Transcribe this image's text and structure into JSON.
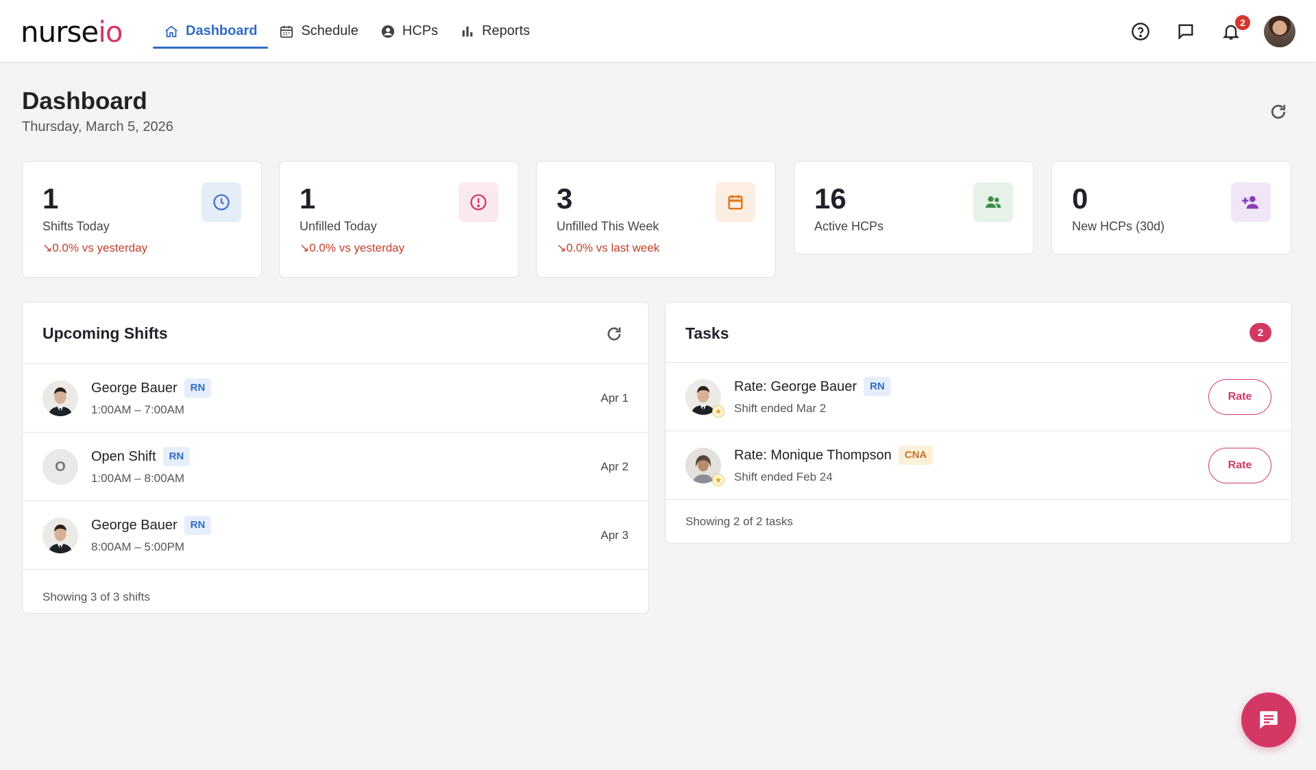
{
  "app": {
    "logo_main": "nurse",
    "logo_accent": "io"
  },
  "nav": {
    "items": [
      {
        "label": "Dashboard",
        "icon": "home-icon",
        "active": true
      },
      {
        "label": "Schedule",
        "icon": "calendar-icon",
        "active": false
      },
      {
        "label": "HCPs",
        "icon": "person-circle-icon",
        "active": false
      },
      {
        "label": "Reports",
        "icon": "bar-chart-icon",
        "active": false
      }
    ]
  },
  "topbar": {
    "notification_count": "2",
    "icons": [
      "help-icon",
      "chat-icon",
      "bell-icon",
      "user-avatar"
    ]
  },
  "header": {
    "title": "Dashboard",
    "date": "Thursday, March 5, 2026"
  },
  "stats": [
    {
      "value": "1",
      "label": "Shifts Today",
      "trend": "↘0.0% vs yesterday",
      "icon": "clock-icon",
      "icon_color": "#3d74c4",
      "icon_bg": "#e5edf8"
    },
    {
      "value": "1",
      "label": "Unfilled Today",
      "trend": "↘0.0% vs yesterday",
      "icon": "alert-circle-icon",
      "icon_color": "#d33865",
      "icon_bg": "#fbe9ee"
    },
    {
      "value": "3",
      "label": "Unfilled This Week",
      "trend": "↘0.0% vs last week",
      "icon": "calendar-icon",
      "icon_color": "#e07a1f",
      "icon_bg": "#fcefe2"
    },
    {
      "value": "16",
      "label": "Active HCPs",
      "icon": "people-icon",
      "icon_color": "#3a8f4a",
      "icon_bg": "#e6f2e7"
    },
    {
      "value": "0",
      "label": "New HCPs (30d)",
      "icon": "person-add-icon",
      "icon_color": "#8a3fb8",
      "icon_bg": "#f1e6f7"
    }
  ],
  "upcoming": {
    "title": "Upcoming Shifts",
    "rows": [
      {
        "name": "George Bauer",
        "role": "RN",
        "time": "1:00AM – 7:00AM",
        "date": "Apr 1",
        "avatar": "photo"
      },
      {
        "name": "Open Shift",
        "role": "RN",
        "time": "1:00AM – 8:00AM",
        "date": "Apr 2",
        "avatar": "O"
      },
      {
        "name": "George Bauer",
        "role": "RN",
        "time": "8:00AM – 5:00PM",
        "date": "Apr 3",
        "avatar": "photo"
      }
    ],
    "footer": "Showing 3 of 3 shifts"
  },
  "tasks": {
    "title": "Tasks",
    "count": "2",
    "rows": [
      {
        "title": "Rate: George Bauer",
        "role": "RN",
        "sub": "Shift ended Mar 2",
        "button": "Rate"
      },
      {
        "title": "Rate: Monique Thompson",
        "role": "CNA",
        "sub": "Shift ended Feb 24",
        "button": "Rate"
      }
    ],
    "footer": "Showing 2 of 2 tasks"
  },
  "colors": {
    "brand": "#d33865",
    "primary": "#2f6cc2",
    "trend_down": "#c0402a"
  }
}
